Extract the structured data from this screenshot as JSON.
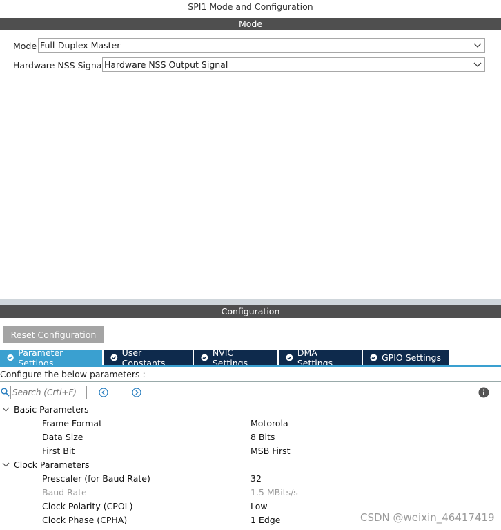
{
  "window": {
    "title": "SPI1 Mode and Configuration"
  },
  "mode_section": {
    "header": "Mode",
    "mode_label": "Mode",
    "mode_value": "Full-Duplex Master",
    "nss_label": "Hardware NSS Signal",
    "nss_value": "Hardware NSS Output Signal"
  },
  "config_section": {
    "header": "Configuration",
    "reset_label": "Reset Configuration",
    "tabs": [
      {
        "label": "Parameter Settings",
        "active": true
      },
      {
        "label": "User Constants",
        "active": false
      },
      {
        "label": "NVIC Settings",
        "active": false
      },
      {
        "label": "DMA Settings",
        "active": false
      },
      {
        "label": "GPIO Settings",
        "active": false
      }
    ],
    "configure_text": "Configure the below parameters :",
    "search_placeholder": "Search (Crtl+F)"
  },
  "parameters": {
    "basic": {
      "label": "Basic Parameters",
      "rows": [
        {
          "name": "Frame Format",
          "value": "Motorola"
        },
        {
          "name": "Data Size",
          "value": "8 Bits"
        },
        {
          "name": "First Bit",
          "value": "MSB First"
        }
      ]
    },
    "clock": {
      "label": "Clock Parameters",
      "rows": [
        {
          "name": "Prescaler (for Baud Rate)",
          "value": "32"
        },
        {
          "name": "Baud Rate",
          "value": "1.5 MBits/s",
          "disabled": true
        },
        {
          "name": "Clock Polarity (CPOL)",
          "value": "Low"
        },
        {
          "name": "Clock Phase (CPHA)",
          "value": "1 Edge"
        }
      ]
    }
  },
  "watermark": "CSDN @weixin_46417419",
  "colors": {
    "tab_active": "#3aa0d0",
    "tab_inactive": "#0e2a4c",
    "section_bar": "#4f4f4f"
  }
}
